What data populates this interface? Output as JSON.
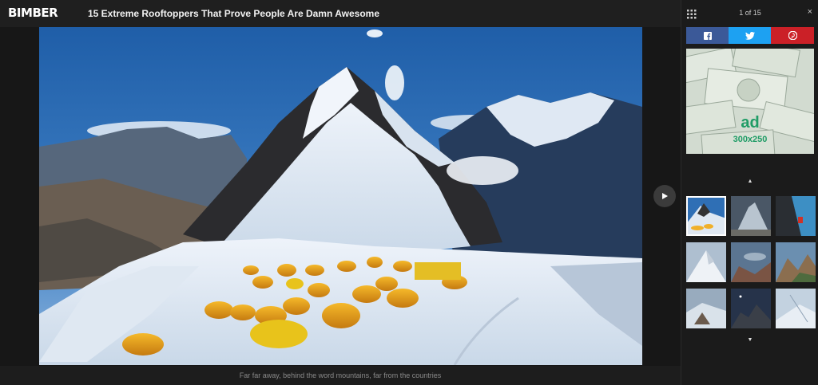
{
  "header": {
    "logo": "BIMBER",
    "title": "15 Extreme Rooftoppers That Prove People Are Damn Awesome"
  },
  "gallery": {
    "caption": "Far far away, behind the word mountains, far from the countries",
    "counter": "1 of 15",
    "close_symbol": "×"
  },
  "share": {
    "facebook_icon": "facebook-icon",
    "twitter_icon": "twitter-icon",
    "pinterest_icon": "pinterest-icon",
    "facebook_color": "#3b5998",
    "twitter_color": "#1da1f2",
    "pinterest_color": "#cb2027"
  },
  "ad": {
    "label": "ad",
    "size": "300x250"
  },
  "thumbnails": {
    "up_arrow": "▲",
    "down_arrow": "▼",
    "items": [
      {
        "name": "thumb-1",
        "active": true
      },
      {
        "name": "thumb-2",
        "active": false
      },
      {
        "name": "thumb-3",
        "active": false
      },
      {
        "name": "thumb-4",
        "active": false
      },
      {
        "name": "thumb-5",
        "active": false
      },
      {
        "name": "thumb-6",
        "active": false
      },
      {
        "name": "thumb-7",
        "active": false
      },
      {
        "name": "thumb-8",
        "active": false
      },
      {
        "name": "thumb-9",
        "active": false
      }
    ]
  }
}
